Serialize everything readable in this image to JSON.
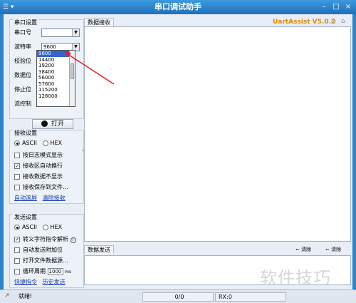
{
  "window": {
    "title": "串口调试助手",
    "menu_icon_label": "☰ ▾",
    "controls": {
      "min": "–",
      "max": "□",
      "close": "×"
    }
  },
  "serial_settings": {
    "title": "串口设置",
    "port_label": "串口号",
    "port_value": "",
    "baud_label": "波特率",
    "baud_value": "9600",
    "check_label": "校验位",
    "data_label": "数据位",
    "stop_label": "停止位",
    "flow_label": "流控制",
    "open_button": "打开"
  },
  "baud_dropdown": {
    "options": [
      "9600",
      "14400",
      "19200",
      "38400",
      "56000",
      "57600",
      "115200",
      "128000"
    ],
    "selected_index": 0
  },
  "receive_settings": {
    "title": "接收设置",
    "ascii": "ASCII",
    "hex": "HEX",
    "mode_selected": "ASCII",
    "opt1": "按日志模式显示",
    "opt2": "接收区自动换行",
    "opt3": "接收数据不显示",
    "opt4": "接收保存到文件...",
    "opt1_checked": false,
    "opt2_checked": true,
    "opt3_checked": false,
    "opt4_checked": false,
    "link_auto": "自动滚屏",
    "link_clear": "清除接收"
  },
  "send_settings": {
    "title": "发送设置",
    "ascii": "ASCII",
    "hex": "HEX",
    "mode_selected": "ASCII",
    "opt1": "转义字符指令解析",
    "opt2": "自动发送附加位",
    "opt3": "打开文件数据源...",
    "opt4": "循环周期",
    "opt1_checked": true,
    "opt2_checked": false,
    "opt3_checked": false,
    "opt4_checked": false,
    "period_value": "1000",
    "period_unit": "ms",
    "link_shortcut": "快捷指令",
    "link_history": "历史发送"
  },
  "receive_panel": {
    "tab": "数据接收",
    "version": "UartAssist V5.0.2"
  },
  "send_panel": {
    "tab": "数据发送",
    "tool_clear1": "清除",
    "tool_clear2": "清除"
  },
  "status_bar": {
    "left": "就绪!",
    "counter": "0/0",
    "rx": "RX:0"
  },
  "watermark": "软件技巧"
}
